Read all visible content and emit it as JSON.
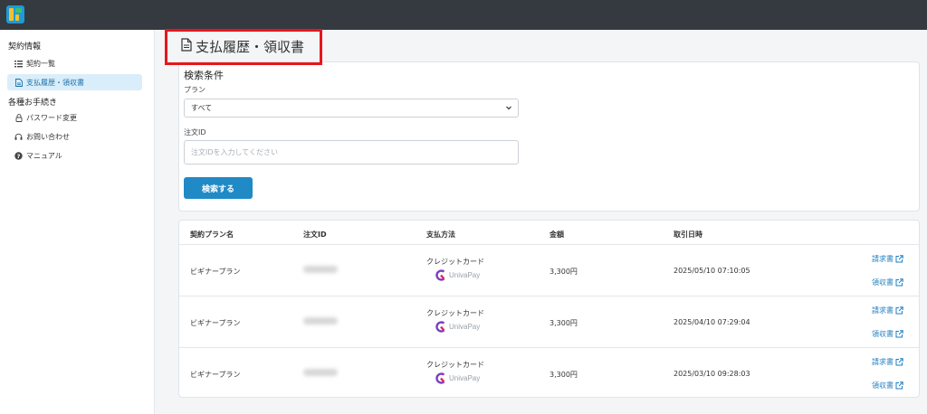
{
  "sidebar": {
    "section_contract": "契約情報",
    "items_contract": [
      {
        "label": "契約一覧",
        "icon": "list-icon"
      },
      {
        "label": "支払履歴・領収書",
        "icon": "document-icon",
        "active": true
      }
    ],
    "section_procedures": "各種お手続き",
    "items_procedures": [
      {
        "label": "パスワード変更",
        "icon": "lock-icon"
      },
      {
        "label": "お問い合わせ",
        "icon": "headset-icon"
      },
      {
        "label": "マニュアル",
        "icon": "question-icon"
      }
    ]
  },
  "page": {
    "title": "支払履歴・領収書"
  },
  "search": {
    "title": "検索条件",
    "plan_label": "プラン",
    "plan_value": "すべて",
    "order_label": "注文ID",
    "order_placeholder": "注文IDを入力してください",
    "order_value": "",
    "button": "検索する"
  },
  "table": {
    "headers": [
      "契約プラン名",
      "注文ID",
      "支払方法",
      "金額",
      "取引日時"
    ],
    "rows": [
      {
        "plan": "ビギナープラン",
        "payment": "クレジットカード",
        "provider": "UnivaPay",
        "amount": "3,300円",
        "datetime": "2025/05/10 07:10:05",
        "invoice": "請求書",
        "receipt": "領収書"
      },
      {
        "plan": "ビギナープラン",
        "payment": "クレジットカード",
        "provider": "UnivaPay",
        "amount": "3,300円",
        "datetime": "2025/04/10 07:29:04",
        "invoice": "請求書",
        "receipt": "領収書"
      },
      {
        "plan": "ビギナープラン",
        "payment": "クレジットカード",
        "provider": "UnivaPay",
        "amount": "3,300円",
        "datetime": "2025/03/10 09:28:03",
        "invoice": "請求書",
        "receipt": "領収書"
      }
    ]
  },
  "colors": {
    "topbar": "#343a40",
    "accent": "#1f8ac6",
    "highlight": "#e8161d",
    "active_bg": "#d9eefa"
  }
}
